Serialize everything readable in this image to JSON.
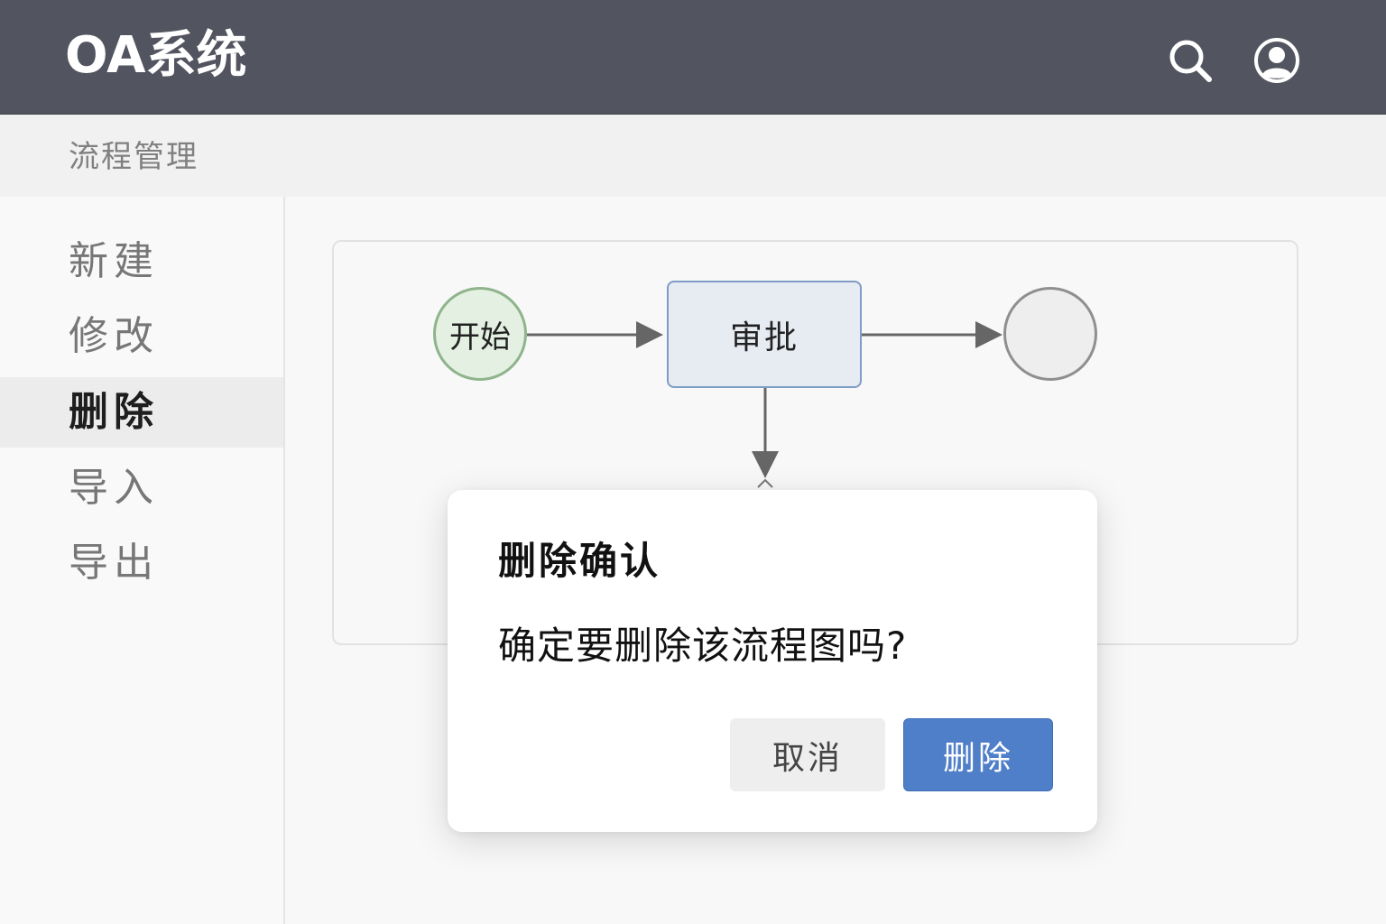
{
  "app": {
    "title": "OA系统"
  },
  "header": {
    "icons": [
      "search-icon",
      "user-icon"
    ]
  },
  "breadcrumb": {
    "label": "流程管理"
  },
  "sidebar": {
    "items": [
      {
        "label": "新建",
        "active": false
      },
      {
        "label": "修改",
        "active": false
      },
      {
        "label": "删除",
        "active": true
      },
      {
        "label": "导入",
        "active": false
      },
      {
        "label": "导出",
        "active": false
      }
    ]
  },
  "flow": {
    "nodes": [
      {
        "id": "start",
        "label": "开始"
      },
      {
        "id": "approve",
        "label": "审批"
      },
      {
        "id": "end",
        "label": ""
      }
    ]
  },
  "dialog": {
    "title": "删除确认",
    "message": "确定要删除该流程图吗?",
    "cancel_label": "取消",
    "confirm_label": "删除"
  },
  "colors": {
    "header_bg": "#52555f",
    "accent": "#4f7fc8",
    "start_node_fill": "#e4f1e2",
    "approve_node_fill": "#e7ebf2"
  }
}
